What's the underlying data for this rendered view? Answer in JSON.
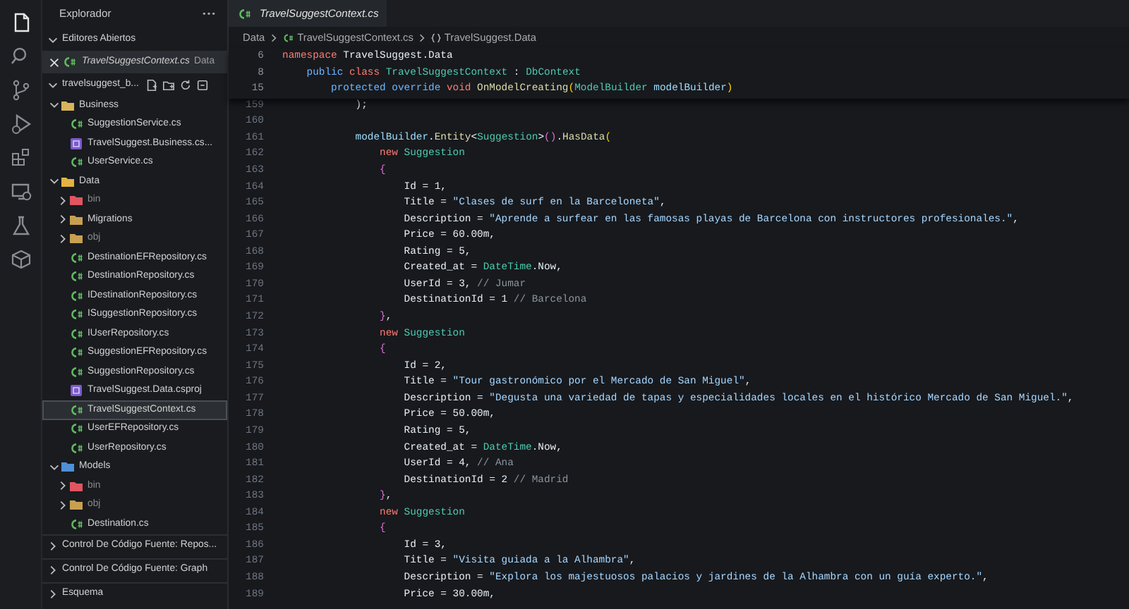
{
  "activity_bar": {
    "items": [
      {
        "kind": "files",
        "selected": true
      },
      {
        "kind": "search",
        "selected": false
      },
      {
        "kind": "branch",
        "selected": false
      },
      {
        "kind": "run",
        "selected": false
      },
      {
        "kind": "extensions",
        "selected": false
      },
      {
        "kind": "remote",
        "selected": false
      },
      {
        "kind": "flask",
        "selected": false
      },
      {
        "kind": "cube",
        "selected": false
      }
    ]
  },
  "sidebar": {
    "title": "Explorador",
    "sections": [
      {
        "kind": "open-editors",
        "title": "Editores Abiertos",
        "expanded": true,
        "items": [
          {
            "name": "TravelSuggestContext.cs",
            "folder": "Data",
            "kind": "csharp",
            "preview": true,
            "selected": true
          }
        ]
      },
      {
        "kind": "tree",
        "title": "travelsuggest_b...",
        "expanded": true,
        "items": [
          {
            "name": "Business",
            "kind": "folder",
            "color": "#d8b45a",
            "expanded": true,
            "selected": false,
            "children": [
              {
                "name": "SuggestionService.cs",
                "kind": "csharp",
                "selected": false
              },
              {
                "name": "TravelSuggest.Business.cs...",
                "kind": "csproj",
                "selected": false
              },
              {
                "name": "UserService.cs",
                "kind": "csharp",
                "selected": false
              }
            ]
          },
          {
            "name": "Data",
            "kind": "folder",
            "color": "#e3b341",
            "expanded": true,
            "selected": false,
            "children": [
              {
                "name": "bin",
                "kind": "folder",
                "color": "#e05561",
                "expanded": false,
                "selected": false,
                "dimmed": true
              },
              {
                "name": "Migrations",
                "kind": "folder",
                "color": "#c9a050",
                "expanded": false,
                "selected": false,
                "dimmed": false
              },
              {
                "name": "obj",
                "kind": "folder",
                "color": "#c9a050",
                "expanded": false,
                "selected": false,
                "dimmed": true
              },
              {
                "name": "DestinationEFRepository.cs",
                "kind": "csharp",
                "selected": false
              },
              {
                "name": "DestinationRepository.cs",
                "kind": "csharp",
                "selected": false
              },
              {
                "name": "IDestinationRepository.cs",
                "kind": "csharp",
                "selected": false
              },
              {
                "name": "ISuggestionRepository.cs",
                "kind": "csharp",
                "selected": false
              },
              {
                "name": "IUserRepository.cs",
                "kind": "csharp",
                "selected": false
              },
              {
                "name": "SuggestionEFRepository.cs",
                "kind": "csharp",
                "selected": false
              },
              {
                "name": "SuggestionRepository.cs",
                "kind": "csharp",
                "selected": false
              },
              {
                "name": "TravelSuggest.Data.csproj",
                "kind": "csproj",
                "selected": false
              },
              {
                "name": "TravelSuggestContext.cs",
                "kind": "csharp",
                "selected": true
              },
              {
                "name": "UserEFRepository.cs",
                "kind": "csharp",
                "selected": false
              },
              {
                "name": "UserRepository.cs",
                "kind": "csharp",
                "selected": false
              }
            ]
          },
          {
            "name": "Models",
            "kind": "folder",
            "color": "#4f8fd6",
            "expanded": true,
            "selected": false,
            "children": [
              {
                "name": "bin",
                "kind": "folder",
                "color": "#e05561",
                "expanded": false,
                "selected": false,
                "dimmed": true
              },
              {
                "name": "obj",
                "kind": "folder",
                "color": "#c9a050",
                "expanded": false,
                "selected": false,
                "dimmed": true
              },
              {
                "name": "Destination.cs",
                "kind": "csharp",
                "selected": false
              }
            ]
          }
        ]
      },
      {
        "kind": "panel",
        "title": "Control De Código Fuente: Repos...",
        "expanded": false
      },
      {
        "kind": "panel",
        "title": "Control De Código Fuente: Graph",
        "expanded": false
      },
      {
        "kind": "panel",
        "title": "Esquema",
        "expanded": false
      }
    ]
  },
  "editor": {
    "tab": {
      "name": "TravelSuggestContext.cs",
      "kind": "csharp",
      "preview": true
    },
    "breadcrumb": [
      {
        "kind": "folder",
        "text": "Data"
      },
      {
        "kind": "csharp",
        "text": "TravelSuggestContext.cs"
      },
      {
        "kind": "namespace",
        "text": "TravelSuggest.Data"
      }
    ],
    "sticky_lines": [
      {
        "number": "6",
        "tokens": [
          {
            "kind": "keyword",
            "text": "namespace"
          },
          {
            "kind": "plain",
            "text": " TravelSuggest.Data"
          }
        ]
      },
      {
        "number": "8",
        "tokens": [
          {
            "kind": "modifier",
            "text": "    public"
          },
          {
            "kind": "keyword",
            "text": " class"
          },
          {
            "kind": "type",
            "text": " TravelSuggestContext"
          },
          {
            "kind": "plain",
            "text": " : "
          },
          {
            "kind": "type",
            "text": "DbContext"
          }
        ]
      },
      {
        "number": "15",
        "tokens": [
          {
            "kind": "modifier",
            "text": "        protected override"
          },
          {
            "kind": "keyword",
            "text": " void"
          },
          {
            "kind": "function",
            "text": " OnModelCreating"
          },
          {
            "kind": "bracket",
            "text": "("
          },
          {
            "kind": "type",
            "text": "ModelBuilder"
          },
          {
            "kind": "variable",
            "text": " modelBuilder"
          },
          {
            "kind": "bracket",
            "text": ")"
          }
        ]
      }
    ],
    "lines": [
      {
        "number": "159",
        "tokens": [
          {
            "kind": "plain",
            "text": "            );"
          }
        ]
      },
      {
        "number": "160"
      },
      {
        "number": "161",
        "tokens": [
          {
            "kind": "variable",
            "text": "            modelBuilder"
          },
          {
            "kind": "plain",
            "text": "."
          },
          {
            "kind": "function",
            "text": "Entity"
          },
          {
            "kind": "plain",
            "text": "<"
          },
          {
            "kind": "type",
            "text": "Suggestion"
          },
          {
            "kind": "plain",
            "text": ">"
          },
          {
            "kind": "brace",
            "text": "()"
          },
          {
            "kind": "plain",
            "text": "."
          },
          {
            "kind": "function",
            "text": "HasData"
          },
          {
            "kind": "bracket",
            "text": "("
          }
        ]
      },
      {
        "number": "162",
        "tokens": [
          {
            "kind": "keyword",
            "text": "                new"
          },
          {
            "kind": "type",
            "text": " Suggestion"
          }
        ]
      },
      {
        "number": "163",
        "tokens": [
          {
            "kind": "brace",
            "text": "                {"
          }
        ]
      },
      {
        "number": "164",
        "tokens": [
          {
            "kind": "plain",
            "text": "                    Id = 1,"
          }
        ]
      },
      {
        "number": "165",
        "tokens": [
          {
            "kind": "plain",
            "text": "                    Title = "
          },
          {
            "kind": "string",
            "text": "\"Clases de surf en la Barceloneta\""
          },
          {
            "kind": "plain",
            "text": ","
          }
        ]
      },
      {
        "number": "166",
        "tokens": [
          {
            "kind": "plain",
            "text": "                    Description = "
          },
          {
            "kind": "string",
            "text": "\"Aprende a surfear en las famosas playas de Barcelona con instructores profesionales.\""
          },
          {
            "kind": "plain",
            "text": ","
          }
        ]
      },
      {
        "number": "167",
        "tokens": [
          {
            "kind": "plain",
            "text": "                    Price = 60.00m,"
          }
        ]
      },
      {
        "number": "168",
        "tokens": [
          {
            "kind": "plain",
            "text": "                    Rating = 5,"
          }
        ]
      },
      {
        "number": "169",
        "tokens": [
          {
            "kind": "plain",
            "text": "                    Created_at = "
          },
          {
            "kind": "type",
            "text": "DateTime"
          },
          {
            "kind": "plain",
            "text": ".Now,"
          }
        ]
      },
      {
        "number": "170",
        "tokens": [
          {
            "kind": "plain",
            "text": "                    UserId = 3, "
          },
          {
            "kind": "comment",
            "text": "// Jumar"
          }
        ]
      },
      {
        "number": "171",
        "tokens": [
          {
            "kind": "plain",
            "text": "                    DestinationId = 1 "
          },
          {
            "kind": "comment",
            "text": "// Barcelona"
          }
        ]
      },
      {
        "number": "172",
        "tokens": [
          {
            "kind": "brace",
            "text": "                }"
          },
          {
            "kind": "plain",
            "text": ","
          }
        ]
      },
      {
        "number": "173",
        "tokens": [
          {
            "kind": "keyword",
            "text": "                new"
          },
          {
            "kind": "type",
            "text": " Suggestion"
          }
        ]
      },
      {
        "number": "174",
        "tokens": [
          {
            "kind": "brace",
            "text": "                {"
          }
        ]
      },
      {
        "number": "175",
        "tokens": [
          {
            "kind": "plain",
            "text": "                    Id = 2,"
          }
        ]
      },
      {
        "number": "176",
        "tokens": [
          {
            "kind": "plain",
            "text": "                    Title = "
          },
          {
            "kind": "string",
            "text": "\"Tour gastronómico por el Mercado de San Miguel\""
          },
          {
            "kind": "plain",
            "text": ","
          }
        ]
      },
      {
        "number": "177",
        "tokens": [
          {
            "kind": "plain",
            "text": "                    Description = "
          },
          {
            "kind": "string",
            "text": "\"Degusta una variedad de tapas y especialidades locales en el histórico Mercado de San Miguel.\""
          },
          {
            "kind": "plain",
            "text": ","
          }
        ]
      },
      {
        "number": "178",
        "tokens": [
          {
            "kind": "plain",
            "text": "                    Price = 50.00m,"
          }
        ]
      },
      {
        "number": "179",
        "tokens": [
          {
            "kind": "plain",
            "text": "                    Rating = 5,"
          }
        ]
      },
      {
        "number": "180",
        "tokens": [
          {
            "kind": "plain",
            "text": "                    Created_at = "
          },
          {
            "kind": "type",
            "text": "DateTime"
          },
          {
            "kind": "plain",
            "text": ".Now,"
          }
        ]
      },
      {
        "number": "181",
        "tokens": [
          {
            "kind": "plain",
            "text": "                    UserId = 4, "
          },
          {
            "kind": "comment",
            "text": "// Ana"
          }
        ]
      },
      {
        "number": "182",
        "tokens": [
          {
            "kind": "plain",
            "text": "                    DestinationId = 2 "
          },
          {
            "kind": "comment",
            "text": "// Madrid"
          }
        ]
      },
      {
        "number": "183",
        "tokens": [
          {
            "kind": "brace",
            "text": "                }"
          },
          {
            "kind": "plain",
            "text": ","
          }
        ]
      },
      {
        "number": "184",
        "tokens": [
          {
            "kind": "keyword",
            "text": "                new"
          },
          {
            "kind": "type",
            "text": " Suggestion"
          }
        ]
      },
      {
        "number": "185",
        "tokens": [
          {
            "kind": "brace",
            "text": "                {"
          }
        ]
      },
      {
        "number": "186",
        "tokens": [
          {
            "kind": "plain",
            "text": "                    Id = 3,"
          }
        ]
      },
      {
        "number": "187",
        "tokens": [
          {
            "kind": "plain",
            "text": "                    Title = "
          },
          {
            "kind": "string",
            "text": "\"Visita guiada a la Alhambra\""
          },
          {
            "kind": "plain",
            "text": ","
          }
        ]
      },
      {
        "number": "188",
        "tokens": [
          {
            "kind": "plain",
            "text": "                    Description = "
          },
          {
            "kind": "string",
            "text": "\"Explora los majestuosos palacios y jardines de la Alhambra con un guía experto.\""
          },
          {
            "kind": "plain",
            "text": ","
          }
        ]
      },
      {
        "number": "189",
        "tokens": [
          {
            "kind": "plain",
            "text": "                    Price = 30.00m,"
          }
        ]
      }
    ]
  }
}
